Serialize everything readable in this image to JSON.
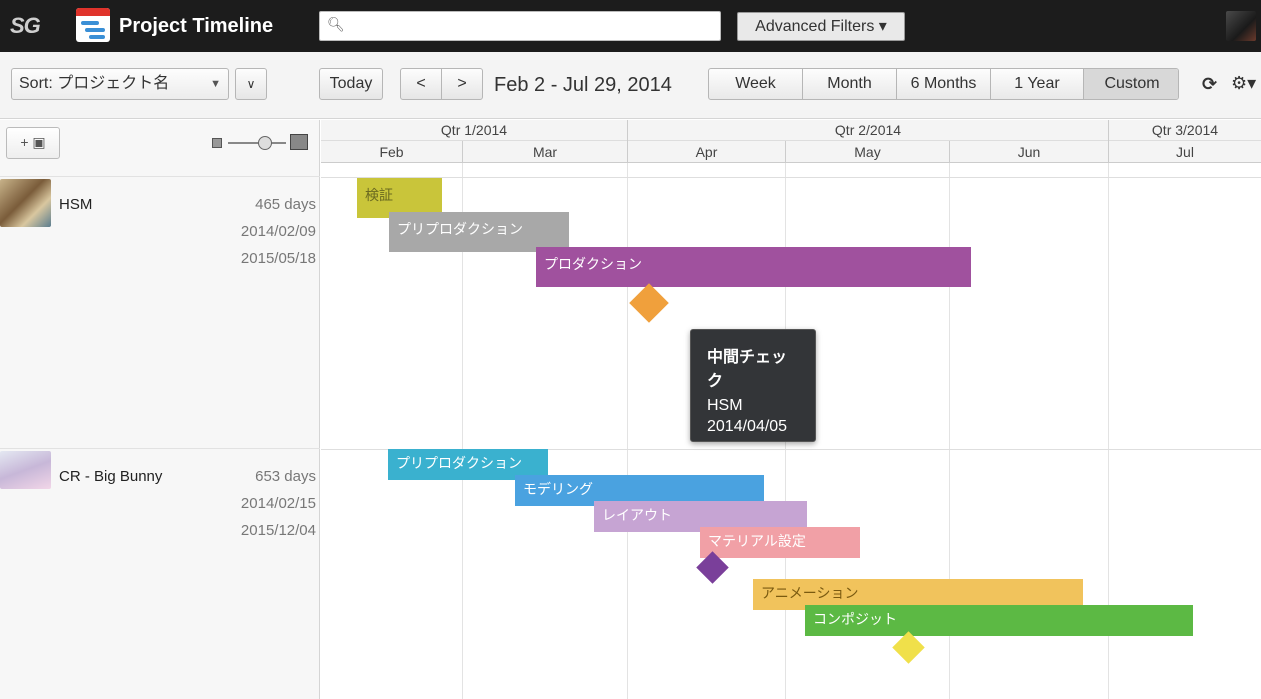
{
  "app": {
    "logo": "SG",
    "title": "Project Timeline"
  },
  "search": {
    "value": "",
    "placeholder": ""
  },
  "header": {
    "advanced_filters": "Advanced Filters ▾"
  },
  "toolbar": {
    "sort_label": "Sort: プロジェクト名",
    "today": "Today",
    "prev": "<",
    "next": ">",
    "date_range": "Feb 2 - Jul 29, 2014",
    "views": [
      "Week",
      "Month",
      "6 Months",
      "1 Year",
      "Custom"
    ],
    "active_view": "Custom"
  },
  "timeline_header": {
    "quarters": [
      "Qtr 1/2014",
      "Qtr 2/2014",
      "Qtr 3/2014"
    ],
    "months": [
      "Feb",
      "Mar",
      "Apr",
      "May",
      "Jun",
      "Jul"
    ]
  },
  "projects": [
    {
      "name": "HSM",
      "duration": "465 days",
      "start": "2014/02/09",
      "end": "2015/05/18",
      "tasks": [
        {
          "label": "検証",
          "color": "#c9c53a"
        },
        {
          "label": "プリプロダクション",
          "color": "#a8a8a8"
        },
        {
          "label": "プロダクション",
          "color": "#a0519e"
        }
      ],
      "milestone_color": "#f0a03c"
    },
    {
      "name": "CR - Big Bunny",
      "duration": "653 days",
      "start": "2014/02/15",
      "end": "2015/12/04",
      "tasks": [
        {
          "label": "プリプロダクション",
          "color": "#3ab1cf"
        },
        {
          "label": "モデリング",
          "color": "#4aa2e0"
        },
        {
          "label": "レイアウト",
          "color": "#c6a4d3"
        },
        {
          "label": "マテリアル設定",
          "color": "#f1a0a6"
        },
        {
          "label": "アニメーション",
          "color": "#f1c35c"
        },
        {
          "label": "コンポジット",
          "color": "#5cb944"
        }
      ],
      "milestone_colors": [
        "#7a3f9a",
        "#f0e04a"
      ]
    }
  ],
  "tooltip": {
    "title": "中間チェック",
    "project": "HSM",
    "date": "2014/04/05"
  }
}
